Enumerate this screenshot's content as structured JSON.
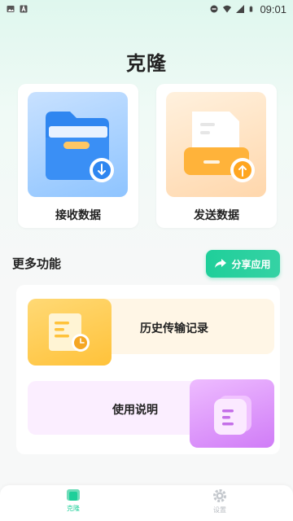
{
  "status_bar": {
    "time": "09:01",
    "left_icons": [
      "image-icon",
      "a-icon"
    ],
    "right_icons": [
      "do-not-disturb-icon",
      "wifi-icon",
      "signal-icon",
      "battery-icon"
    ]
  },
  "header": {
    "title": "克隆"
  },
  "actions": {
    "receive": {
      "label": "接收数据",
      "icon": "folder-download-icon"
    },
    "send": {
      "label": "发送数据",
      "icon": "document-upload-icon"
    }
  },
  "more": {
    "title": "更多功能",
    "share_label": "分享应用",
    "items": [
      {
        "label": "历史传输记录",
        "icon": "history-document-icon"
      },
      {
        "label": "使用说明",
        "icon": "manual-document-icon"
      }
    ]
  },
  "bottom_nav": {
    "items": [
      {
        "label": "克隆",
        "icon": "clone-icon",
        "active": true
      },
      {
        "label": "设置",
        "icon": "settings-icon",
        "active": false
      }
    ]
  },
  "colors": {
    "accent": "#1fcf9a",
    "receive_card": "#8ec4ff",
    "send_card": "#ffd7ac",
    "history_card": "#ffc23a",
    "manual_card": "#d07cf7"
  }
}
